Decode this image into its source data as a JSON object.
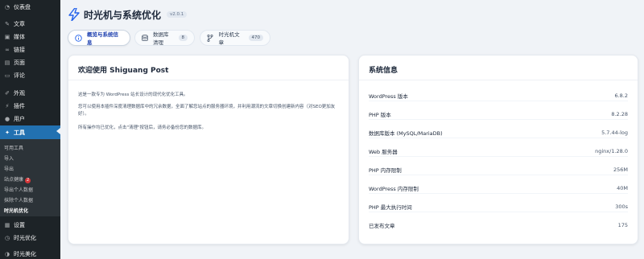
{
  "sidebar": {
    "items": [
      {
        "label": "仪表盘",
        "icon": "dashboard-icon",
        "glyph": "◔"
      },
      {
        "label": "文章",
        "icon": "pin-icon",
        "glyph": "✎"
      },
      {
        "label": "媒体",
        "icon": "media-icon",
        "glyph": "▣"
      },
      {
        "label": "链接",
        "icon": "link-icon",
        "glyph": "∞"
      },
      {
        "label": "页面",
        "icon": "page-icon",
        "glyph": "▤"
      },
      {
        "label": "评论",
        "icon": "comment-icon",
        "glyph": "▭"
      },
      {
        "label": "外观",
        "icon": "brush-icon",
        "glyph": "✐"
      },
      {
        "label": "插件",
        "icon": "plugin-icon",
        "glyph": "⚡"
      },
      {
        "label": "用户",
        "icon": "user-icon",
        "glyph": "●"
      },
      {
        "label": "工具",
        "icon": "wrench-icon",
        "glyph": "✦"
      },
      {
        "label": "设置",
        "icon": "settings-icon",
        "glyph": "▦"
      },
      {
        "label": "时光优化",
        "icon": "clock-icon",
        "glyph": "◷"
      },
      {
        "label": "时光美化",
        "icon": "palette-icon",
        "glyph": "◑"
      }
    ],
    "submenu": [
      {
        "label": "可用工具"
      },
      {
        "label": "导入"
      },
      {
        "label": "导出"
      },
      {
        "label": "站点健康",
        "badge": "2"
      },
      {
        "label": "导出个人数据"
      },
      {
        "label": "抹除个人数据"
      },
      {
        "label": "时光机优化"
      }
    ]
  },
  "header": {
    "title": "时光机与系统优化",
    "version": "v2.0.1"
  },
  "tabs": [
    {
      "label": "概览与系统信息"
    },
    {
      "label": "数据库清理",
      "count": "8"
    },
    {
      "label": "时光机文章",
      "count": "470"
    }
  ],
  "welcome": {
    "title": "欢迎使用 Shiguang Post",
    "paragraphs": [
      "这是一款专为 WordPress 站长设计的现代化优化工具。",
      "您可以使用本插件深度清理数据库中的冗余数据，全面了解您站点的服务器环境，并利用潮流的文章切换创建新内容（对SEO更加友好）。",
      "所有操作均已优化，点击\"清理\"按钮后，请务必备份您的数据库。"
    ]
  },
  "system": {
    "title": "系统信息",
    "rows": [
      {
        "label": "WordPress 版本",
        "value": "6.8.2"
      },
      {
        "label": "PHP 版本",
        "value": "8.2.28"
      },
      {
        "label": "数据库版本 (MySQL/MariaDB)",
        "value": "5.7.44-log"
      },
      {
        "label": "Web 服务器",
        "value": "nginx/1.28.0"
      },
      {
        "label": "PHP 内存限制",
        "value": "256M"
      },
      {
        "label": "WordPress 内存限制",
        "value": "40M"
      },
      {
        "label": "PHP 最大执行时间",
        "value": "300s"
      },
      {
        "label": "已发布文章",
        "value": "175"
      }
    ]
  },
  "colors": {
    "sidebar_bg": "#1d2327",
    "active_menu": "#2271b1",
    "accent": "#2563eb",
    "badge": "#d63638"
  }
}
